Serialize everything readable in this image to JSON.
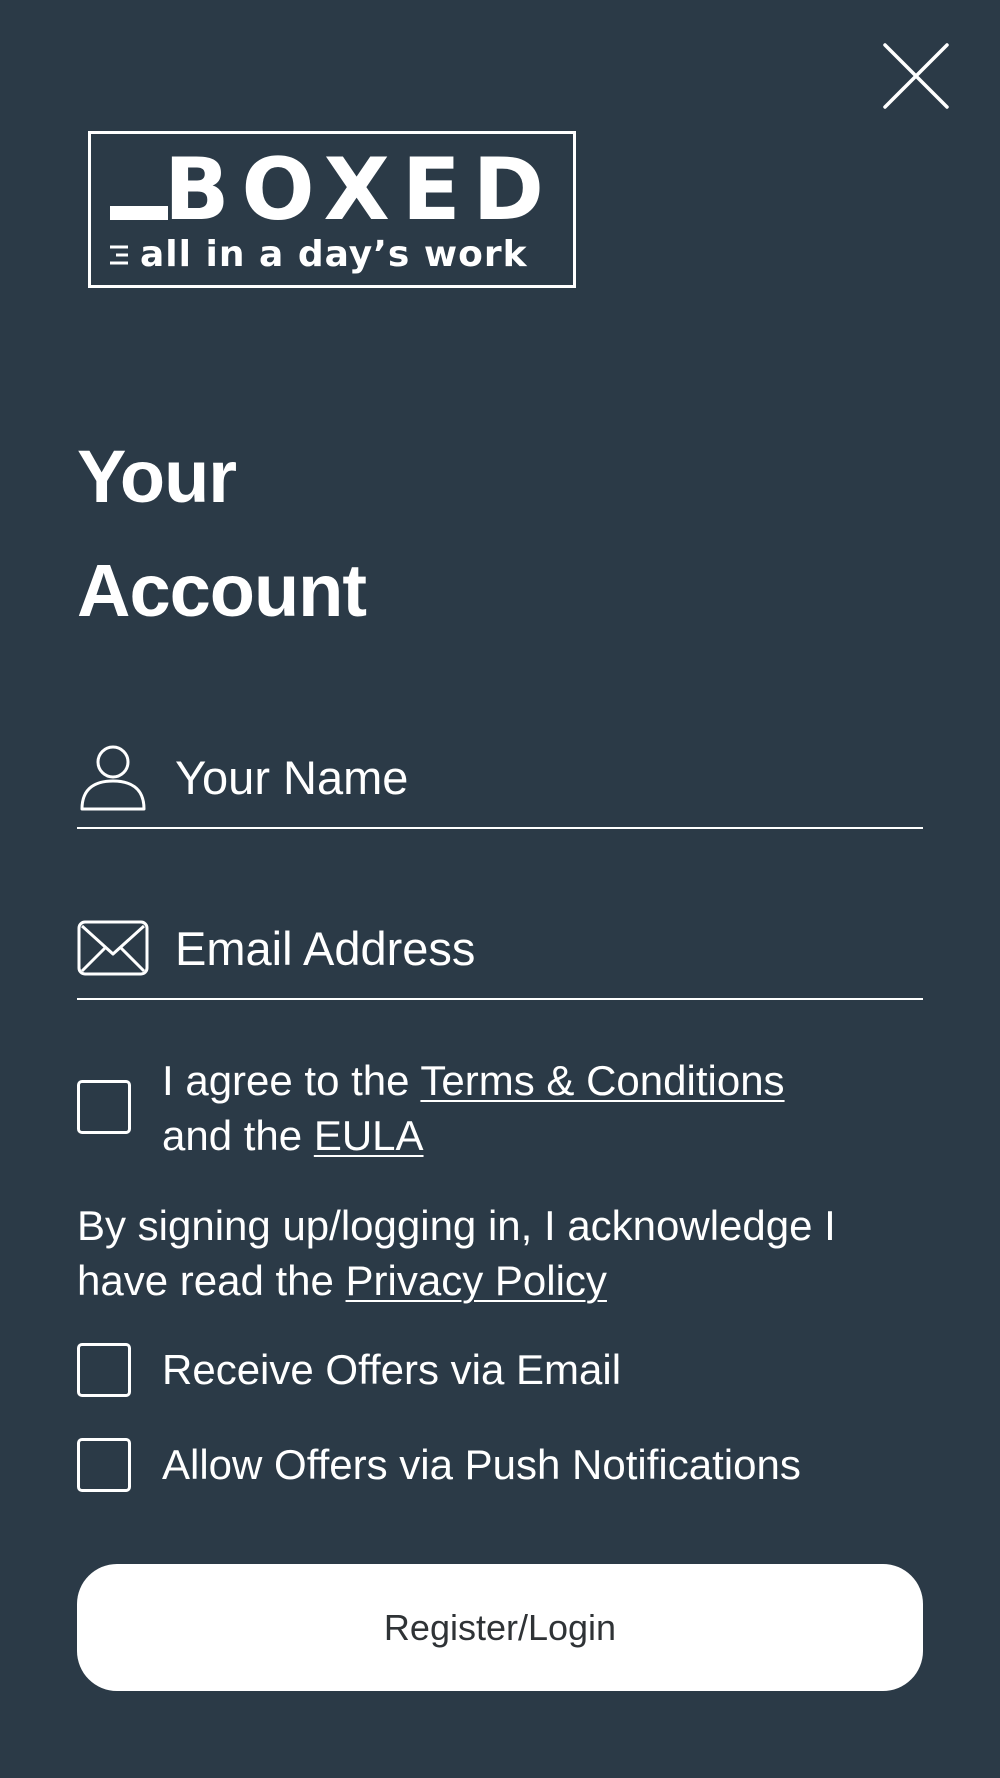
{
  "header": {
    "close_icon": "close-icon",
    "logo": {
      "brand": "BOXED",
      "tagline": "all in a day’s work"
    }
  },
  "title": {
    "line1": "Your",
    "line2": "Account"
  },
  "form": {
    "name_field": {
      "icon": "user-icon",
      "placeholder": "Your Name",
      "value": ""
    },
    "email_field": {
      "icon": "envelope-icon",
      "placeholder": "Email Address",
      "value": ""
    },
    "terms": {
      "prefix": "I agree to the ",
      "terms_link": "Terms & Conditions",
      "middle": " and the ",
      "eula_link": "EULA",
      "checked": false
    },
    "acknowledge": {
      "prefix": "By signing up/logging in, I acknowledge I have read the ",
      "privacy_link": "Privacy Policy"
    },
    "offers_email": {
      "label": "Receive Offers via Email",
      "checked": false
    },
    "offers_push": {
      "label": "Allow Offers via Push Notifications",
      "checked": false
    },
    "submit_label": "Register/Login"
  },
  "colors": {
    "background": "#2b3a47",
    "foreground": "#ffffff",
    "button_background": "#ffffff",
    "button_text": "#2f3336"
  }
}
